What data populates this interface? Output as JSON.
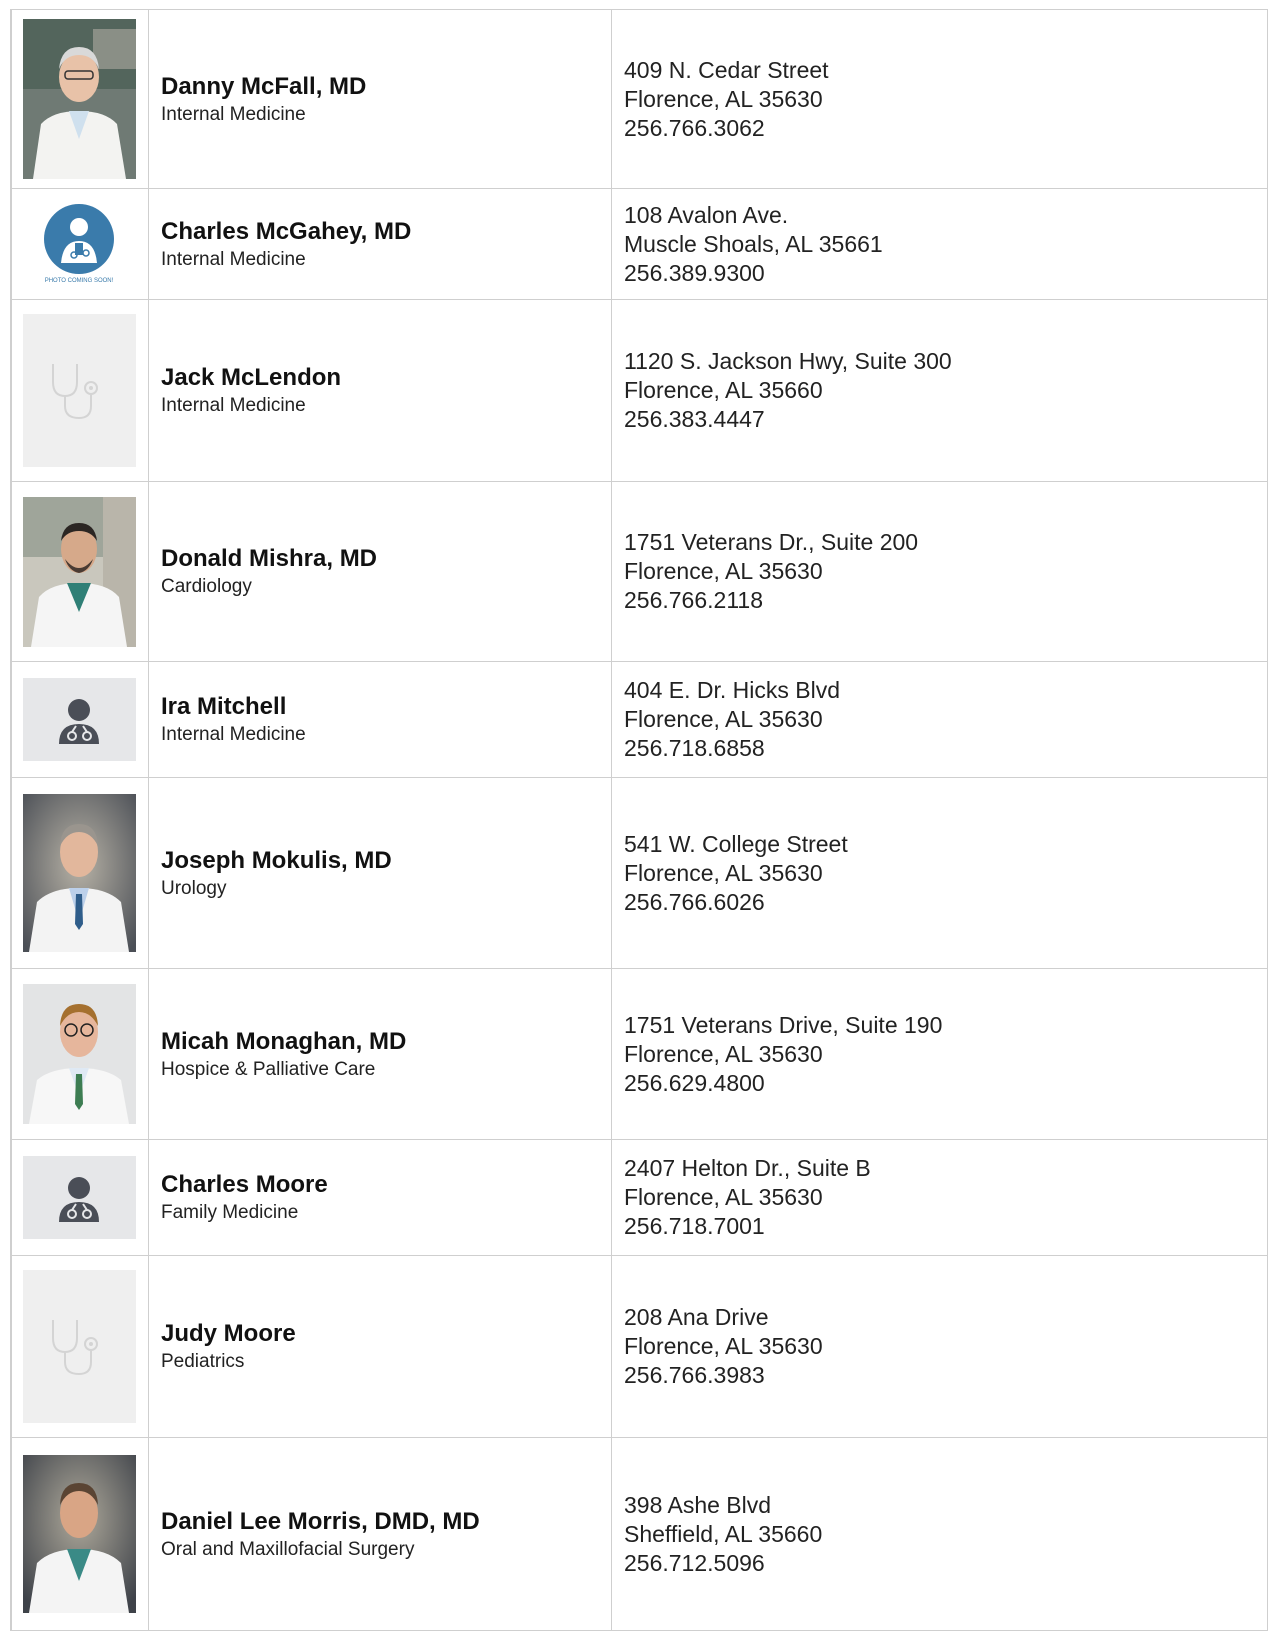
{
  "colors": {
    "border": "#cfcfcf",
    "placeholder_blue": "#3a7bab",
    "placeholder_gray": "#e6e7e9",
    "placeholder_icon": "#4a4e57"
  },
  "placeholders": {
    "coming_soon": "PHOTO COMING SOON!"
  },
  "providers": [
    {
      "name": "Danny McFall, MD",
      "specialty": "Internal Medicine",
      "address1": "409 N. Cedar Street",
      "address2": "Florence, AL 35630",
      "phone": "256.766.3062",
      "photo": "photo-portrait"
    },
    {
      "name": "Charles McGahey, MD",
      "specialty": "Internal Medicine",
      "address1": "108 Avalon Ave.",
      "address2": "Muscle Shoals, AL 35661",
      "phone": "256.389.9300",
      "photo": "photo-coming-soon-icon"
    },
    {
      "name": "Jack McLendon",
      "specialty": "Internal Medicine",
      "address1": "1120 S. Jackson Hwy, Suite 300",
      "address2": "Florence, AL 35660",
      "phone": "256.383.4447",
      "photo": "stethoscope-icon"
    },
    {
      "name": "Donald Mishra, MD",
      "specialty": "Cardiology",
      "address1": "1751 Veterans Dr., Suite 200",
      "address2": "Florence, AL 35630",
      "phone": "256.766.2118",
      "photo": "photo-portrait"
    },
    {
      "name": "Ira Mitchell",
      "specialty": "Internal Medicine",
      "address1": "404 E. Dr. Hicks Blvd",
      "address2": "Florence, AL 35630",
      "phone": "256.718.6858",
      "photo": "doctor-avatar-icon"
    },
    {
      "name": "Joseph Mokulis, MD",
      "specialty": "Urology",
      "address1": "541 W. College Street",
      "address2": "Florence, AL 35630",
      "phone": "256.766.6026",
      "photo": "photo-portrait"
    },
    {
      "name": "Micah Monaghan, MD",
      "specialty": "Hospice & Palliative Care",
      "address1": "1751 Veterans Drive, Suite 190",
      "address2": "Florence, AL 35630",
      "phone": "256.629.4800",
      "photo": "photo-portrait"
    },
    {
      "name": "Charles Moore",
      "specialty": "Family Medicine",
      "address1": "2407 Helton Dr., Suite B",
      "address2": "Florence, AL 35630",
      "phone": "256.718.7001",
      "photo": "doctor-avatar-icon"
    },
    {
      "name": "Judy Moore",
      "specialty": "Pediatrics",
      "address1": "208 Ana Drive",
      "address2": "Florence, AL 35630",
      "phone": "256.766.3983",
      "photo": "stethoscope-icon"
    },
    {
      "name": "Daniel Lee Morris, DMD, MD",
      "specialty": "Oral and Maxillofacial Surgery",
      "address1": "398 Ashe Blvd",
      "address2": "Sheffield, AL 35660",
      "phone": "256.712.5096",
      "photo": "photo-portrait"
    }
  ]
}
